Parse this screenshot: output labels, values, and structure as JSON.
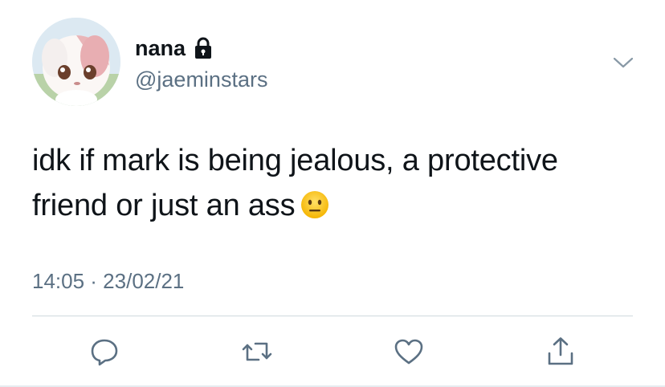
{
  "tweet": {
    "display_name": "nana",
    "handle": "@jaeminstars",
    "text": "idk if mark is being jealous, a protective friend or just an ass",
    "emoji": "😐",
    "timestamp": "14:05 · 23/02/21",
    "protected": true
  },
  "icons": {
    "lock": "lock-icon",
    "chevron": "chevron-down-icon",
    "reply": "reply-icon",
    "retweet": "retweet-icon",
    "like": "heart-icon",
    "share": "share-icon"
  },
  "colors": {
    "text": "#0f1419",
    "secondary": "#5b7083",
    "divider": "#cfd9de"
  }
}
